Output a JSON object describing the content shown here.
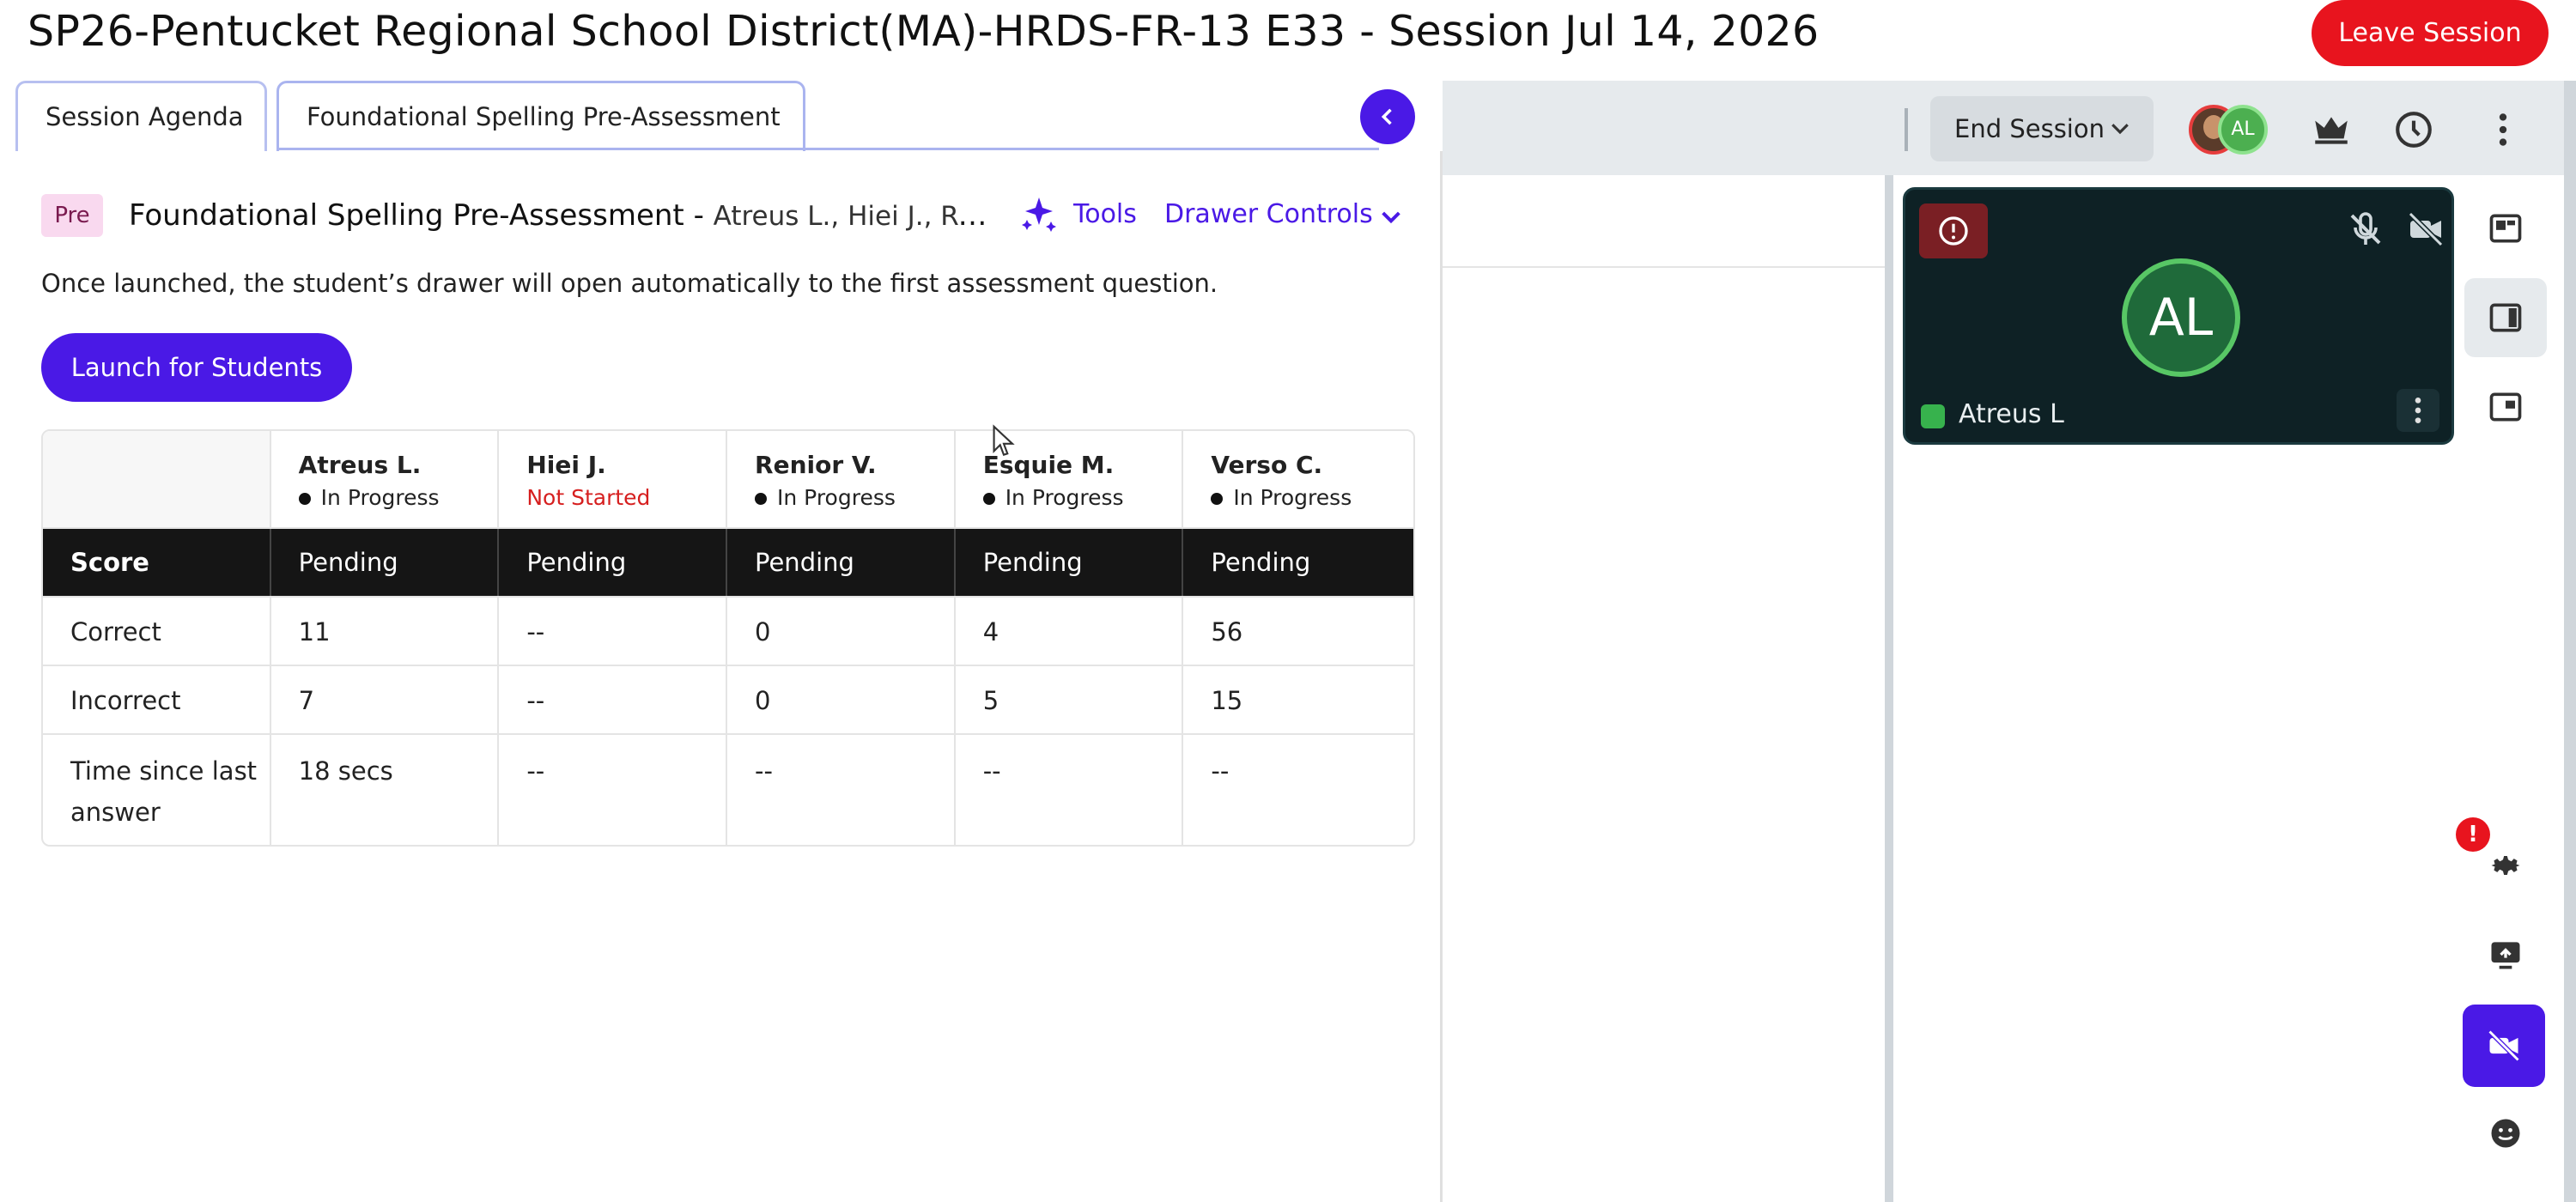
{
  "header": {
    "title": "SP26-Pentucket Regional School District(MA)-HRDS-FR-13 E33 - Session Jul 14, 2026",
    "leave_label": "Leave Session"
  },
  "toolbar": {
    "end_session_label": "End Session",
    "avatar_initials": "AL"
  },
  "tabs": [
    {
      "label": "Session Agenda"
    },
    {
      "label": "Foundational Spelling Pre-Assessment"
    }
  ],
  "assessment": {
    "badge": "Pre",
    "title": "Foundational Spelling Pre-Assessment",
    "separator": "-",
    "students_summary": "Atreus L., Hiei J., Re...",
    "tools_label": "Tools",
    "drawer_controls_label": "Drawer Controls",
    "info_text": "Once launched, the student’s drawer will open automatically to the first assessment question.",
    "launch_label": "Launch for Students"
  },
  "table": {
    "students": [
      {
        "name": "Atreus L.",
        "status": "In Progress"
      },
      {
        "name": "Hiei J.",
        "status": "Not Started"
      },
      {
        "name": "Renior V.",
        "status": "In Progress"
      },
      {
        "name": "Esquie M.",
        "status": "In Progress"
      },
      {
        "name": "Verso C.",
        "status": "In Progress"
      }
    ],
    "rows": [
      {
        "label": "Score",
        "values": [
          "Pending",
          "Pending",
          "Pending",
          "Pending",
          "Pending"
        ]
      },
      {
        "label": "Correct",
        "values": [
          "11",
          "--",
          "0",
          "4",
          "56"
        ]
      },
      {
        "label": "Incorrect",
        "values": [
          "7",
          "--",
          "0",
          "5",
          "15"
        ]
      },
      {
        "label": "Time since last answer",
        "values": [
          "18 secs",
          "--",
          "--",
          "--",
          "--"
        ]
      }
    ]
  },
  "video": {
    "initials": "AL",
    "participant_name": "Atreus L"
  },
  "rail": {
    "badge": "!"
  },
  "colors": {
    "accent": "#4a19e6",
    "leave": "#e8141e",
    "tile_bg": "#0e2125",
    "status_not_started": "#d61f1f"
  }
}
